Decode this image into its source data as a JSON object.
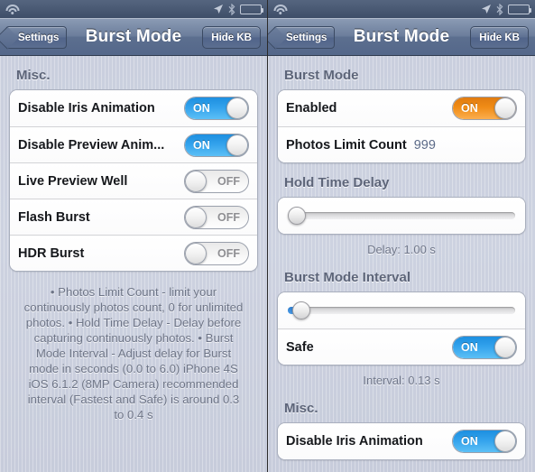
{
  "statusbar": {
    "wifi_icon": "wifi-icon",
    "location_icon": "location-arrow-icon",
    "bluetooth_icon": "bluetooth-icon",
    "battery_icon": "battery-icon"
  },
  "left": {
    "nav": {
      "back_label": "Settings",
      "title": "Burst Mode",
      "right_label": "Hide KB"
    },
    "sections": [
      {
        "header": "Misc.",
        "rows": [
          {
            "label": "Disable Iris Animation",
            "toggle": "ON",
            "state": "on"
          },
          {
            "label": "Disable Preview Anim...",
            "toggle": "ON",
            "state": "on"
          },
          {
            "label": "Live Preview Well",
            "toggle": "OFF",
            "state": "off"
          },
          {
            "label": "Flash Burst",
            "toggle": "OFF",
            "state": "off"
          },
          {
            "label": "HDR Burst",
            "toggle": "OFF",
            "state": "off"
          }
        ]
      }
    ],
    "footer_note": "• Photos Limit Count - limit your continuously photos count, 0 for unlimited photos.\n• Hold Time Delay - Delay before capturing continuously photos.\n• Burst Mode Interval - Adjust delay for Burst mode in seconds (0.0 to 6.0) iPhone 4S iOS 6.1.2 (8MP Camera) recommended interval (Fastest and Safe) is around 0.3 to 0.4 s"
  },
  "right": {
    "nav": {
      "back_label": "Settings",
      "title": "Burst Mode",
      "right_label": "Hide KB"
    },
    "burst_mode": {
      "header": "Burst Mode",
      "enabled_label": "Enabled",
      "enabled_toggle": "ON",
      "photos_limit_label": "Photos Limit Count",
      "photos_limit_value": "999"
    },
    "hold_time_delay": {
      "header": "Hold Time Delay",
      "slider_percent": 0,
      "caption": "Delay: 1.00 s"
    },
    "burst_interval": {
      "header": "Burst Mode Interval",
      "slider_percent": 2,
      "safe_label": "Safe",
      "safe_toggle": "ON",
      "caption": "Interval: 0.13 s"
    },
    "misc": {
      "header": "Misc.",
      "row_label": "Disable Iris Animation",
      "row_toggle": "ON"
    }
  },
  "colors": {
    "toggle_on_blue": "#33a2ec",
    "toggle_on_orange": "#f08c16",
    "value_text": "#5b6a88",
    "nav_bar": "#5c6f8f"
  }
}
